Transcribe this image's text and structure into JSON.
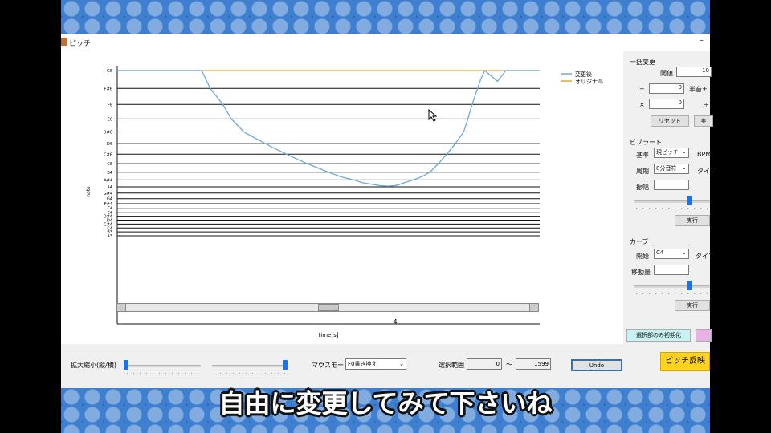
{
  "window": {
    "title": "ピッチ",
    "minimize": "–"
  },
  "chart_data": {
    "type": "line",
    "ylabel": "note",
    "xlabel": "time[s]",
    "x_tick": "4",
    "y_ticks": [
      "G6",
      "F#6",
      "F6",
      "E6",
      "D#6",
      "D6",
      "C#6",
      "C6",
      "B4",
      "A#4",
      "A4",
      "G#4",
      "G4",
      "F#4",
      "F4",
      "E4",
      "D#4",
      "D4",
      "C#4",
      "C4",
      "B3",
      "A3"
    ],
    "legend": [
      "変更後",
      "オリジナル"
    ],
    "colors": {
      "changed": "#6ea8dc",
      "original": "#e8a640"
    },
    "series": [
      {
        "name": "変更後",
        "values": [
          [
            0,
            0
          ],
          [
            0.2,
            0
          ],
          [
            0.22,
            1
          ],
          [
            0.25,
            2
          ],
          [
            0.27,
            3
          ],
          [
            0.3,
            4
          ],
          [
            0.33,
            4.6
          ],
          [
            0.37,
            5.4
          ],
          [
            0.41,
            6.2
          ],
          [
            0.45,
            7
          ],
          [
            0.48,
            7.6
          ],
          [
            0.5,
            8
          ],
          [
            0.53,
            8.6
          ],
          [
            0.56,
            9
          ],
          [
            0.58,
            9.4
          ],
          [
            0.6,
            9.6
          ],
          [
            0.62,
            9.8
          ],
          [
            0.64,
            9.9
          ],
          [
            0.66,
            9.8
          ],
          [
            0.68,
            9.4
          ],
          [
            0.7,
            9
          ],
          [
            0.72,
            8.6
          ],
          [
            0.74,
            8
          ],
          [
            0.76,
            7
          ],
          [
            0.78,
            6
          ],
          [
            0.8,
            5
          ],
          [
            0.82,
            4
          ],
          [
            0.83,
            3
          ],
          [
            0.84,
            2
          ],
          [
            0.86,
            0.5
          ],
          [
            0.87,
            0
          ],
          [
            0.9,
            0.6
          ],
          [
            0.92,
            0
          ],
          [
            1,
            0
          ]
        ]
      },
      {
        "name": "オリジナル",
        "values": [
          [
            0,
            0
          ],
          [
            1,
            0
          ]
        ]
      }
    ]
  },
  "side": {
    "bulk_title": "一括変更",
    "threshold_label": "閾値",
    "threshold_value": "10",
    "semitone_label": "半音±",
    "plus_label": "±",
    "plus_value": "0",
    "times_label": "×",
    "times_value": "0",
    "div_label": "÷",
    "reset": "リセット",
    "exec1": "実",
    "vibrato_title": "ビブラート",
    "base_label": "基準",
    "base_value": "現ピッチ",
    "bpm_label": "BPM",
    "period_label": "周期",
    "period_value": "8分音符",
    "type_label": "タイプ",
    "amp_label": "振幅",
    "exec2": "実行",
    "curve_title": "カーブ",
    "start_label": "開始",
    "start_value": "C4",
    "type2_label": "タイプ",
    "move_label": "移動量",
    "exec3": "実行",
    "select_init": "選択部のみ初期化"
  },
  "bottom": {
    "zoom_label": "拡大縮小(縦/横)",
    "mouse_mode_label": "マウスモード",
    "mouse_mode_value": "F0書き換え",
    "range_label": "選択範囲",
    "range_start": "0",
    "range_tilde": "〜",
    "range_end": "1599",
    "undo": "Undo",
    "apply": "ピッチ反映"
  },
  "subtitle": "自由に変更してみて下さいね"
}
